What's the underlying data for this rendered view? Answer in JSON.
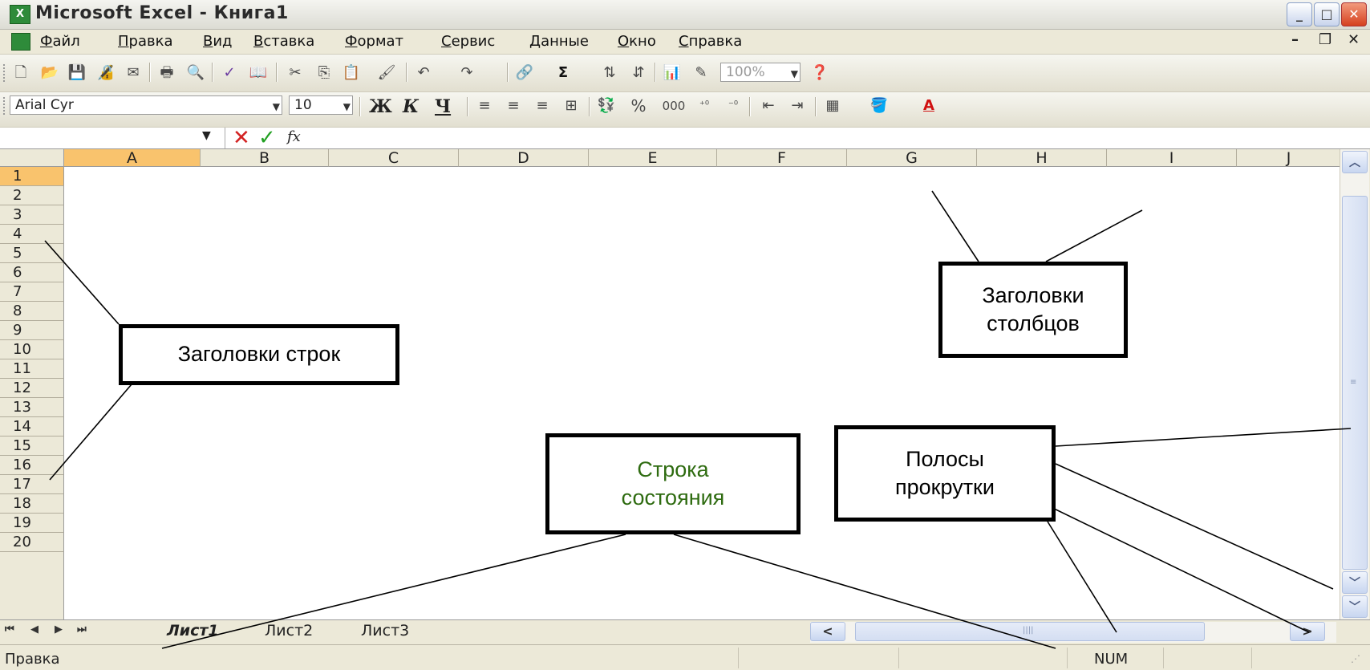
{
  "window": {
    "title": "Microsoft Excel - Книга1",
    "app_icon": "excel-icon"
  },
  "menu": {
    "items": [
      "Файл",
      "Правка",
      "Вид",
      "Вставка",
      "Формат",
      "Сервис",
      "Данные",
      "Окно",
      "Справка"
    ]
  },
  "toolbar_formatting": {
    "font_name": "Arial Cyr",
    "font_size": "10",
    "bold_label": "Ж",
    "italic_label": "К",
    "underline_label": "Ч",
    "percent_label": "%",
    "thousands_label": "000"
  },
  "toolbar_standard": {
    "zoom": "100%",
    "sum_label": "Σ"
  },
  "formula_bar": {
    "fx_label": "fx"
  },
  "grid": {
    "columns": [
      "A",
      "B",
      "C",
      "D",
      "E",
      "F",
      "G",
      "H",
      "I",
      "J"
    ],
    "rows": [
      "1",
      "2",
      "3",
      "4",
      "5",
      "6",
      "7",
      "8",
      "9",
      "10",
      "11",
      "12",
      "13",
      "14",
      "15",
      "16",
      "17",
      "18",
      "19",
      "20"
    ],
    "selected_column": "A",
    "selected_row": "1"
  },
  "sheets": {
    "tabs": [
      "Лист1",
      "Лист2",
      "Лист3"
    ],
    "active": "Лист1"
  },
  "status_bar": {
    "text": "Правка",
    "num": "NUM"
  },
  "callouts": {
    "row_headers": "Заголовки строк",
    "column_headers": "Заголовки\nстолбцов",
    "status_bar": "Строка\nсостояния",
    "scrollbars": "Полосы\nпрокрутки"
  },
  "colors": {
    "selected_header": "#f9c36d",
    "status_callout_text": "#2e6b10"
  }
}
